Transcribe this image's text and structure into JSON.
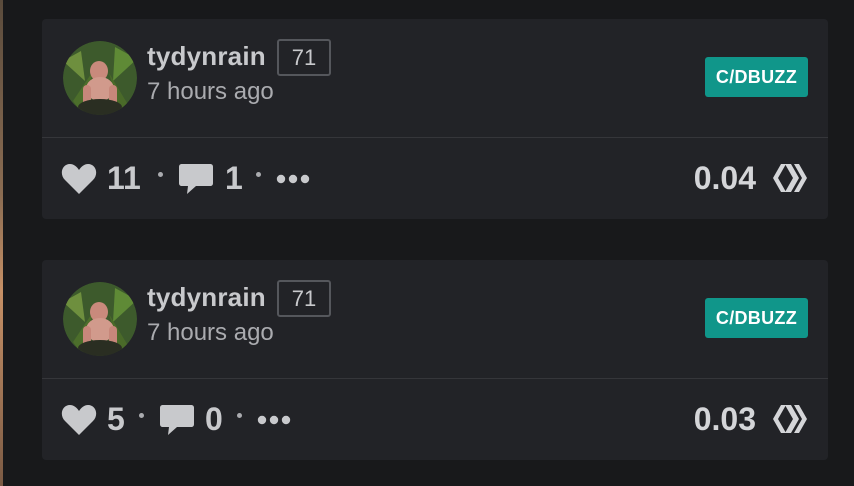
{
  "accent_color": "#10968a",
  "posts": [
    {
      "author": "tydynrain",
      "reputation": "71",
      "time_ago": "7 hours ago",
      "community": "C/DBUZZ",
      "votes": "11",
      "comments": "1",
      "payout": "0.04",
      "icons": {
        "vote": "heart-icon",
        "comment": "speech-bubble-icon",
        "more": "ellipsis-icon",
        "currency": "hive-icon"
      }
    },
    {
      "author": "tydynrain",
      "reputation": "71",
      "time_ago": "7 hours ago",
      "community": "C/DBUZZ",
      "votes": "5",
      "comments": "0",
      "payout": "0.03",
      "icons": {
        "vote": "heart-icon",
        "comment": "speech-bubble-icon",
        "more": "ellipsis-icon",
        "currency": "hive-icon"
      }
    }
  ]
}
